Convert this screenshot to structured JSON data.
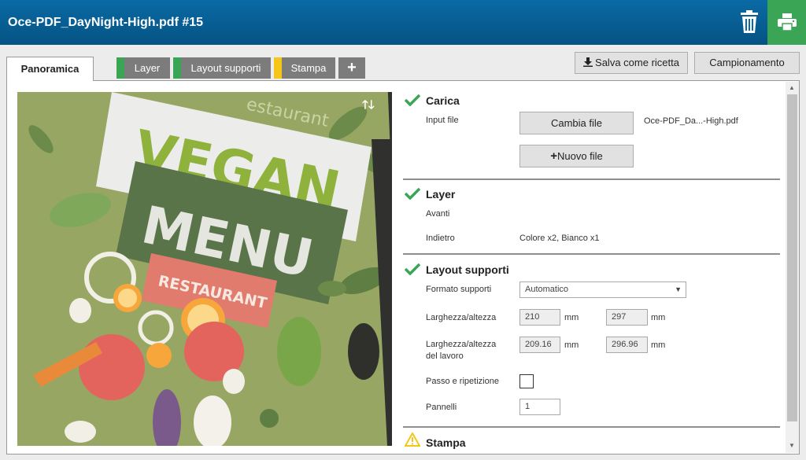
{
  "header": {
    "title": "Oce-PDF_DayNight-High.pdf #15"
  },
  "tabs": [
    {
      "label": "Panoramica",
      "active": true
    },
    {
      "label": "Layer",
      "stripe": "#3aa655"
    },
    {
      "label": "Layout supporti",
      "stripe": "#3aa655"
    },
    {
      "label": "Stampa",
      "stripe": "#f5c518"
    }
  ],
  "toolbar": {
    "save_recipe": "Salva come ricetta",
    "sampling": "Campionamento"
  },
  "preview": {
    "title_line1": "VEGAN",
    "title_line2": "MENU",
    "subtitle": "RESTAURANT",
    "top_text": "estaurant"
  },
  "carica": {
    "title": "Carica",
    "input_label": "Input file",
    "change_button": "Cambia file",
    "filename": "Oce-PDF_Da...-High.pdf",
    "new_button": "Nuovo file"
  },
  "layer": {
    "title": "Layer",
    "front_label": "Avanti",
    "back_label": "Indietro",
    "back_value": "Colore x2, Bianco x1"
  },
  "layout": {
    "title": "Layout supporti",
    "format_label": "Formato supporti",
    "format_value": "Automatico",
    "size_label": "Larghezza/altezza",
    "width": "210",
    "height": "297",
    "unit": "mm",
    "work_label_1": "Larghezza/altezza",
    "work_label_2": "del lavoro",
    "work_width": "209.16",
    "work_height": "296.96",
    "step_label": "Passo e ripetizione",
    "panels_label": "Pannelli",
    "panels_value": "1"
  },
  "stampa": {
    "title": "Stampa"
  },
  "colors": {
    "header": "#0a6aa5",
    "accent_green": "#3aa655",
    "warning": "#f5c518"
  }
}
